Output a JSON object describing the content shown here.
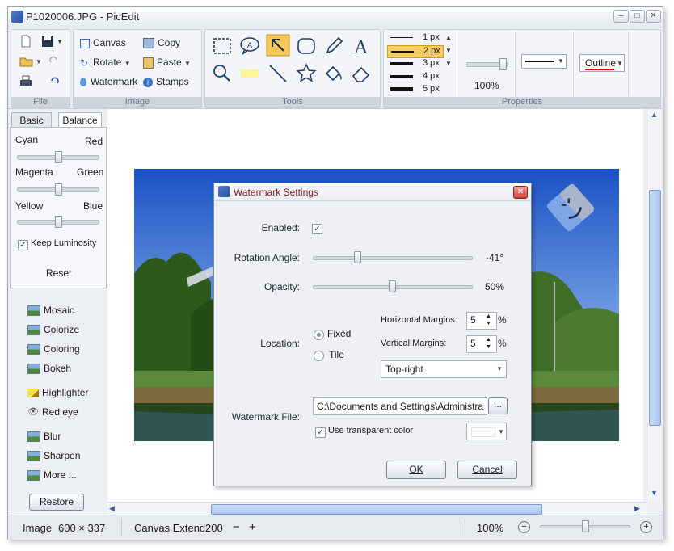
{
  "window": {
    "title": "P1020006.JPG - PicEdit"
  },
  "ribbon": {
    "file": {
      "label": "File"
    },
    "image": {
      "label": "Image",
      "canvas": "Canvas",
      "copy": "Copy",
      "rotate": "Rotate",
      "paste": "Paste",
      "watermark": "Watermark",
      "stamps": "Stamps"
    },
    "tools": {
      "label": "Tools"
    },
    "properties": {
      "label": "Properties",
      "line_sizes": [
        "1 px",
        "2 px",
        "3 px",
        "4 px",
        "5 px"
      ],
      "selected_size": "2 px",
      "zoom_percent": "100%",
      "outline_label": "Outline"
    }
  },
  "left_panel": {
    "tabs": [
      "Basic",
      "Balance"
    ],
    "active_tab": "Balance",
    "balance": {
      "cyan": "Cyan",
      "red": "Red",
      "magenta": "Magenta",
      "green": "Green",
      "yellow": "Yellow",
      "blue": "Blue",
      "keep_luminosity": "Keep Luminosity",
      "reset": "Reset"
    },
    "effects": [
      "Mosaic",
      "Colorize",
      "Coloring",
      "Bokeh",
      "Highlighter",
      "Red eye",
      "Blur",
      "Sharpen",
      "More ..."
    ],
    "restore": "Restore"
  },
  "status": {
    "image_label": "Image",
    "image_size": "600 × 337",
    "canvas_extend_label": "Canvas Extend",
    "canvas_extend_value": "200",
    "minus": "−",
    "plus": "+",
    "zoom": "100%"
  },
  "dialog": {
    "title": "Watermark Settings",
    "enabled_label": "Enabled:",
    "rotation_label": "Rotation Angle:",
    "rotation_value": "-41°",
    "opacity_label": "Opacity:",
    "opacity_value": "50%",
    "location_label": "Location:",
    "fixed": "Fixed",
    "tile": "Tile",
    "h_margins_label": "Horizontal Margins:",
    "h_margins_value": "5",
    "v_margins_label": "Vertical Margins:",
    "v_margins_value": "5",
    "percent": "%",
    "position_value": "Top-right",
    "file_label": "Watermark File:",
    "file_path": "C:\\Documents and Settings\\Administra",
    "browse": "...",
    "use_transparent": "Use transparent color",
    "ok": "OK",
    "cancel": "Cancel"
  }
}
